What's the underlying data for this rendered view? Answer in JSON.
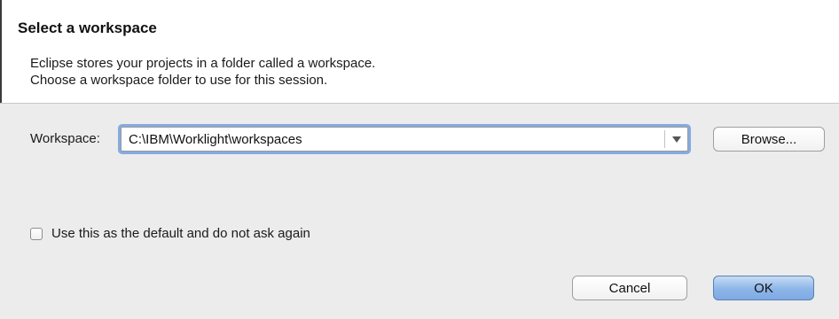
{
  "header": {
    "title": "Select a workspace",
    "description_line1": "Eclipse stores your projects in a folder called a workspace.",
    "description_line2": "Choose a workspace folder to use for this session."
  },
  "workspace": {
    "label": "Workspace:",
    "value": "C:\\IBM\\Worklight\\workspaces",
    "browse_label": "Browse..."
  },
  "options": {
    "default_checkbox_label": "Use this as the default and do not ask again",
    "default_checked": false
  },
  "footer": {
    "cancel_label": "Cancel",
    "ok_label": "OK"
  },
  "colors": {
    "dialog_bg": "#ececec",
    "header_bg": "#ffffff",
    "focus_ring": "#84abe0",
    "ok_button": "#8cb5e8"
  },
  "icons": {
    "combo_dropdown": "chevron-down-icon"
  }
}
